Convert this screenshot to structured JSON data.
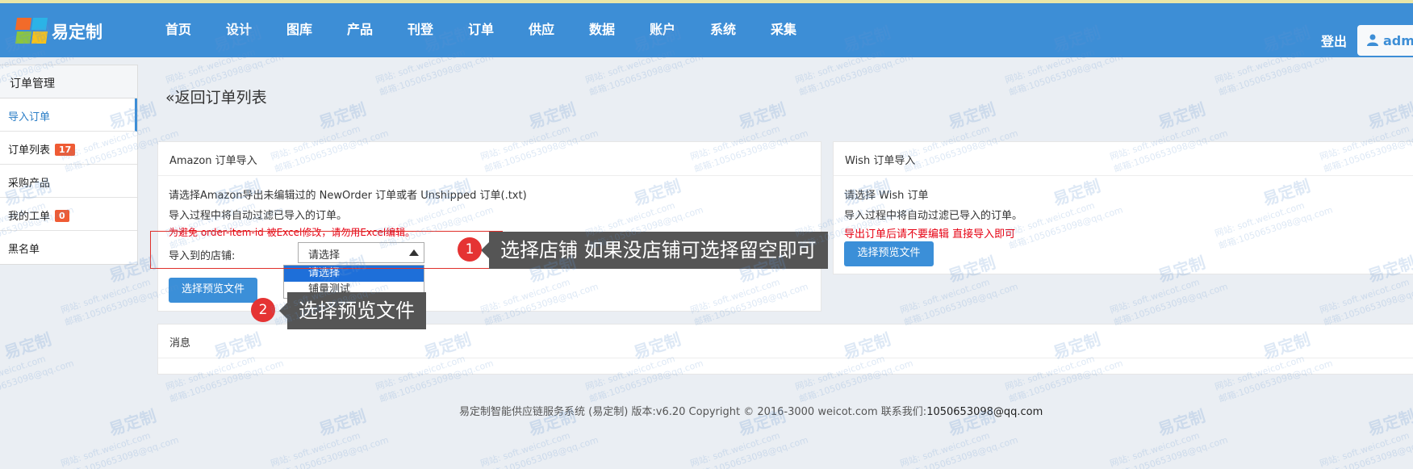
{
  "header": {
    "brand": "易定制",
    "nav": [
      "首页",
      "设计",
      "图库",
      "产品",
      "刊登",
      "订单",
      "供应",
      "数据",
      "账户",
      "系统",
      "采集"
    ],
    "logout": "登出",
    "user": "adm"
  },
  "sidebar": {
    "title": "订单管理",
    "items": [
      {
        "label": "导入订单",
        "badge": null
      },
      {
        "label": "订单列表",
        "badge": "17"
      },
      {
        "label": "采购产品",
        "badge": null
      },
      {
        "label": "我的工单",
        "badge": "0"
      },
      {
        "label": "黑名单",
        "badge": null
      }
    ]
  },
  "main": {
    "back_link": "«返回订单列表",
    "amazon": {
      "title": "Amazon 订单导入",
      "line1": "请选择Amazon导出未编辑过的 NewOrder 订单或者 Unshipped 订单(.txt)",
      "line2": "导入过程中将自动过滤已导入的订单。",
      "warning": "为避免 order-item-id 被Excel修改，请勿用Excel编辑。",
      "store_label": "导入到的店铺:",
      "store_select_value": "请选择",
      "store_options": [
        "请选择",
        "铺量测试"
      ],
      "button": "选择预览文件"
    },
    "wish": {
      "title": "Wish 订单导入",
      "line1": "请选择 Wish 订单",
      "line2": "导入过程中将自动过滤已导入的订单。",
      "warning": "导出订单后请不要编辑 直接导入即可",
      "button": "选择预览文件"
    },
    "messages": {
      "title": "消息"
    }
  },
  "annotations": [
    {
      "number": "1",
      "text": "选择店铺 如果没店铺可选择留空即可"
    },
    {
      "number": "2",
      "text": "选择预览文件"
    }
  ],
  "footer": {
    "text": "易定制智能供应链服务系统 (易定制) 版本:v6.20 Copyright © 2016-3000 weicot.com 联系我们:",
    "email": "1050653098@qq.com"
  },
  "watermark": {
    "brand": "易定制",
    "site": "网站: soft.weicot.com",
    "mail": "邮箱:1050653098@qq.com"
  },
  "colors": {
    "header_bg": "#3d8ed6",
    "accent": "#3b8fd8",
    "warning": "#e60012",
    "badge": "#ef5b34",
    "callout_bg": "#555555",
    "callout_number": "#e53333"
  }
}
